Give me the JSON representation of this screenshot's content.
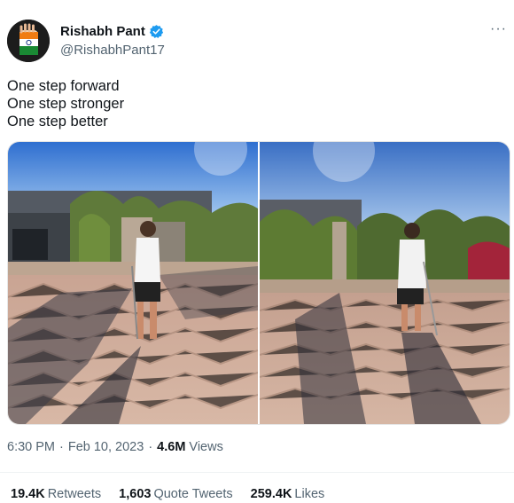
{
  "author": {
    "name": "Rishabh Pant",
    "handle": "@RishabhPant17",
    "avatar_icon": "india-flag-hand-avatar",
    "verified_icon": "verified-badge-icon",
    "verified_color": "#1d9bf0"
  },
  "more_icon": "···",
  "tweet": {
    "lines": [
      "One step forward",
      "One step stronger",
      "One step better"
    ]
  },
  "media": {
    "photo_count": 2
  },
  "meta": {
    "time": "6:30 PM",
    "date": "Feb 10, 2023",
    "separator": "·",
    "views_count": "4.6M",
    "views_label": "Views"
  },
  "stats": {
    "retweets_count": "19.4K",
    "retweets_label": "Retweets",
    "quotes_count": "1,603",
    "quotes_label": "Quote Tweets",
    "likes_count": "259.4K",
    "likes_label": "Likes"
  }
}
